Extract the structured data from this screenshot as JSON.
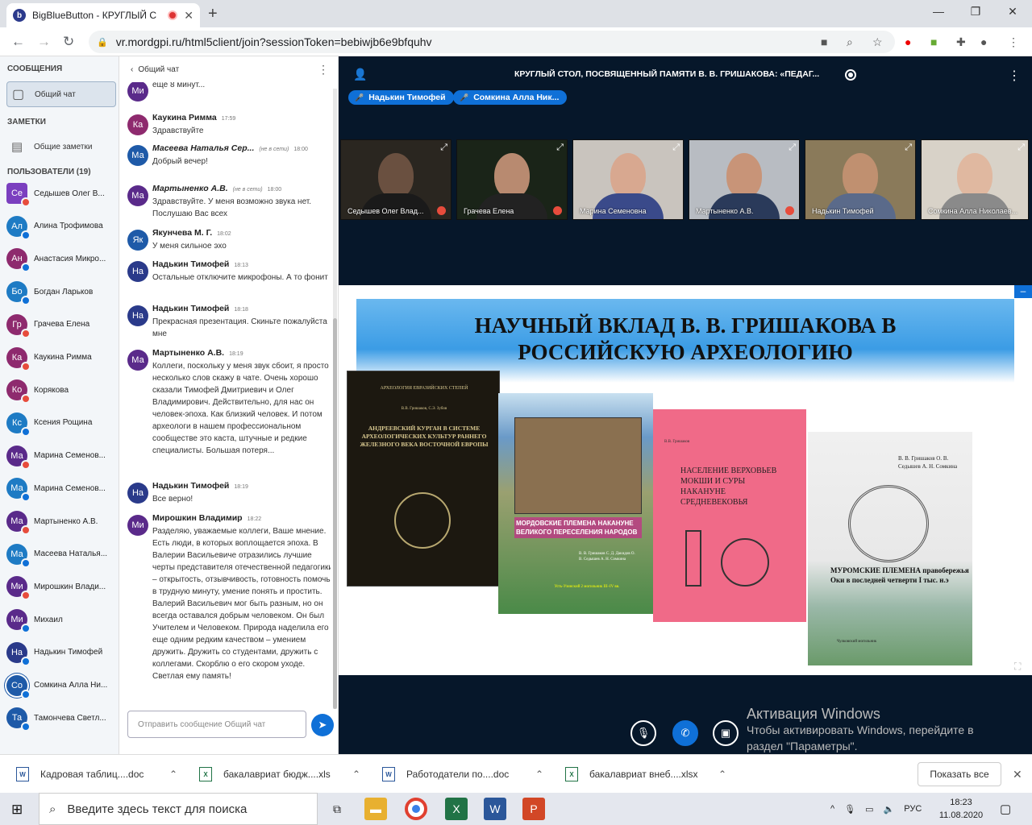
{
  "browser": {
    "tab_title": "BigBlueButton - КРУГЛЫЙ С",
    "url": "vr.mordgpi.ru/html5client/join?sessionToken=bebiwjb6e9bfquhv"
  },
  "left_panel": {
    "messages_header": "СООБЩЕНИЯ",
    "public_chat": "Общий чат",
    "notes_header": "ЗАМЕТКИ",
    "shared_notes": "Общие заметки",
    "users_header": "ПОЛЬЗОВАТЕЛИ (19)",
    "users": [
      {
        "initials": "Се",
        "name": "Седышев Олег В...",
        "color": "#7b3fbf",
        "status": "muted",
        "square": true
      },
      {
        "initials": "Ал",
        "name": "Алина Трофимова",
        "color": "#1e7bc4",
        "status": "listen"
      },
      {
        "initials": "Ан",
        "name": "Анастасия Микро...",
        "color": "#8e2a6e",
        "status": "listen"
      },
      {
        "initials": "Бо",
        "name": "Богдан Ларьков",
        "color": "#1e7bc4",
        "status": "listen"
      },
      {
        "initials": "Гр",
        "name": "Грачева Елена",
        "color": "#8e2a6e",
        "status": "muted"
      },
      {
        "initials": "Ка",
        "name": "Каукина Римма",
        "color": "#8e2a6e",
        "status": "muted"
      },
      {
        "initials": "Ко",
        "name": "Корякова",
        "color": "#8e2a6e",
        "status": "muted"
      },
      {
        "initials": "Кс",
        "name": "Ксения Рощина",
        "color": "#1e7bc4",
        "status": "listen"
      },
      {
        "initials": "Ма",
        "name": "Марина Семенов...",
        "color": "#5a2a8a",
        "status": "muted"
      },
      {
        "initials": "Ма",
        "name": "Марина Семенов...",
        "color": "#1e7bc4",
        "status": "listen"
      },
      {
        "initials": "Ма",
        "name": "Мартыненко А.В.",
        "color": "#5a2a8a",
        "status": "muted"
      },
      {
        "initials": "Ма",
        "name": "Масеева Наталья...",
        "color": "#1e7bc4",
        "status": "listen"
      },
      {
        "initials": "Ми",
        "name": "Мирошкин Влади...",
        "color": "#5a2a8a",
        "status": "muted"
      },
      {
        "initials": "Ми",
        "name": "Михаил",
        "color": "#5a2a8a",
        "status": "listen"
      },
      {
        "initials": "На",
        "name": "Надькин Тимофей",
        "color": "#2a3a8a",
        "status": "listen"
      },
      {
        "initials": "Со",
        "name": "Сомкина Алла Ни...",
        "color": "#1e5aa8",
        "status": "listen",
        "ring": true
      },
      {
        "initials": "Та",
        "name": "Тамончева Светл...",
        "color": "#1e5aa8",
        "status": "listen"
      }
    ]
  },
  "chat": {
    "title": "Общий чат",
    "input_placeholder": "Отправить сообщение Общий чат",
    "messages": [
      {
        "initials": "Ми",
        "color": "#5a2a8a",
        "name": "",
        "time": "",
        "offline": false,
        "text": "еще 8 минут..."
      },
      {
        "initials": "Ка",
        "color": "#8e2a6e",
        "name": "Каукина Римма",
        "time": "17:59",
        "offline": false,
        "text": "Здравствуйте"
      },
      {
        "initials": "Ма",
        "color": "#1e5aa8",
        "name": "Масеева Наталья Сер...",
        "time": "18:00",
        "offline": true,
        "offline_label": "(не в сети)",
        "text": "Добрый вечер!"
      },
      {
        "initials": "Ма",
        "color": "#5a2a8a",
        "name": "Мартыненко А.В.",
        "time": "18:00",
        "offline": true,
        "offline_label": "(не в сети)",
        "text": "Здравствуйте. У меня возможно звука нет. Послушаю Вас всех"
      },
      {
        "initials": "Як",
        "color": "#1e5aa8",
        "name": "Якунчева М. Г.",
        "time": "18:02",
        "offline": false,
        "text": "У меня сильное эхо"
      },
      {
        "initials": "На",
        "color": "#2a3a8a",
        "name": "Надькин Тимофей",
        "time": "18:13",
        "offline": false,
        "text": "Остальные отключите микрофоны. А то фонит"
      },
      {
        "initials": "На",
        "color": "#2a3a8a",
        "name": "Надькин Тимофей",
        "time": "18:18",
        "offline": false,
        "text": "Прекрасная презентация. Скиньте пожалуйста мне"
      },
      {
        "initials": "Ма",
        "color": "#5a2a8a",
        "name": "Мартыненко А.В.",
        "time": "18:19",
        "offline": false,
        "text": "Коллеги, поскольку у меня звук сбоит, я просто несколько слов скажу в чате. Очень хорошо сказали Тимофей Дмитриевич и Олег Владимирович. Действительно, для нас он человек-эпоха. Как близкий человек. И потом археологи в нашем профессиональном сообществе это каста, штучные и редкие специалисты. Большая потеря..."
      },
      {
        "initials": "На",
        "color": "#2a3a8a",
        "name": "Надькин Тимофей",
        "time": "18:19",
        "offline": false,
        "text": "Все верно!"
      },
      {
        "initials": "Ми",
        "color": "#5a2a8a",
        "name": "Мирошкин Владимир",
        "time": "18:22",
        "offline": false,
        "text": "Разделяю, уважаемые коллеги, Ваше мнение. Есть люди, в которых воплощается эпоха. В Валерии Васильевиче отразились лучшие черты представителя отечественной педагогики – открытость, отзывчивость, готовность помочь в трудную минуту, умение понять и простить. Валерий Васильевич мог быть разным, но он всегда оставался добрым человеком. Он был Учителем и Человеком. Природа наделила его еще одним редким качеством – умением дружить. Дружить со студентами, дружить с коллегами. Скорблю о его скором уходе. Светлая ему память!"
      }
    ]
  },
  "meeting": {
    "title": "КРУГЛЫЙ СТОЛ, ПОСВЯЩЕННЫЙ ПАМЯТИ В. В. ГРИШАКОВА: «ПЕДАГ...",
    "talkers": [
      "Надькин Тимофей",
      "Сомкина Алла Ник..."
    ],
    "videos": [
      {
        "name": "Седышев Олег Влад...",
        "muted": true,
        "bg": "#2a2620",
        "skin": "#6a5040",
        "shirt": "#1a1a1a"
      },
      {
        "name": "Грачева Елена",
        "muted": true,
        "bg": "#1a2418",
        "skin": "#b88a70",
        "shirt": "#222"
      },
      {
        "name": "Марина Семеновна",
        "muted": false,
        "bg": "#c9c4be",
        "skin": "#d8a890",
        "shirt": "#3a4a8a"
      },
      {
        "name": "Мартыненко А.В.",
        "muted": true,
        "bg": "#b8bcc2",
        "skin": "#c89478",
        "shirt": "#2a3a5a"
      },
      {
        "name": "Надькин Тимофей",
        "muted": false,
        "bg": "#8a7a5a",
        "skin": "#c09070",
        "shirt": "#5a6a8a"
      },
      {
        "name": "Сомкина Алла Николаев...",
        "muted": false,
        "bg": "#d8d2c8",
        "skin": "#e0b8a0",
        "shirt": "#8a8a8a"
      }
    ]
  },
  "slide": {
    "title_line1": "НАУЧНЫЙ ВКЛАД В. В. ГРИШАКОВА В",
    "title_line2": "РОССИЙСКУЮ АРХЕОЛОГИЮ",
    "books": [
      {
        "series": "АРХЕОЛОГИЯ ЕВРАЗИЙСКИХ СТЕПЕЙ",
        "authors": "В.В. Гришаков, С.Э. Зубов",
        "title": "АНДРЕЕВСКИЙ КУРГАН В СИСТЕМЕ АРХЕОЛОГИЧЕСКИХ КУЛЬТУР РАННЕГО ЖЕЛЕЗНОГО ВЕКА ВОСТОЧНОЙ ЕВРОПЫ"
      },
      {
        "title": "МОРДОВСКИЕ ПЛЕМЕНА НАКАНУНЕ ВЕЛИКОГО ПЕРЕСЕЛЕНИЯ НАРОДОВ",
        "authors": "В. В. Гришаков С. Д. Дакидов О. В. Седышев А. Н. Сомкина",
        "site": "Усть-Узинский 2 могильник III–IV вв."
      },
      {
        "authors": "В.В. Гришаков",
        "title": "НАСЕЛЕНИЕ ВЕРХОВЬЕВ МОКШИ И СУРЫ НАКАНУНЕ СРЕДНЕВЕКОВЬЯ"
      },
      {
        "authors": "В. В. Гришаков О. В. Седышев А. Н. Сомкина",
        "title": "МУРОМСКИЕ ПЛЕМЕНА правобережья Оки в последней четверти I тыс. н.э",
        "site": "Чулковский могильник"
      }
    ]
  },
  "activation": {
    "line1": "Активация Windows",
    "line2": "Чтобы активировать Windows, перейдите в",
    "line3": "раздел \"Параметры\"."
  },
  "downloads": {
    "items": [
      {
        "name": "Кадровая таблиц....doc",
        "type": "W",
        "color": "#2b579a"
      },
      {
        "name": "бакалавриат бюдж....xls",
        "type": "X",
        "color": "#217346"
      },
      {
        "name": "Работодатели по....doc",
        "type": "W",
        "color": "#2b579a"
      },
      {
        "name": "бакалавриат внеб....xlsx",
        "type": "X",
        "color": "#217346"
      }
    ],
    "show_all": "Показать все"
  },
  "taskbar": {
    "search_placeholder": "Введите здесь текст для поиска",
    "lang": "РУС",
    "time": "18:23",
    "date": "11.08.2020"
  }
}
